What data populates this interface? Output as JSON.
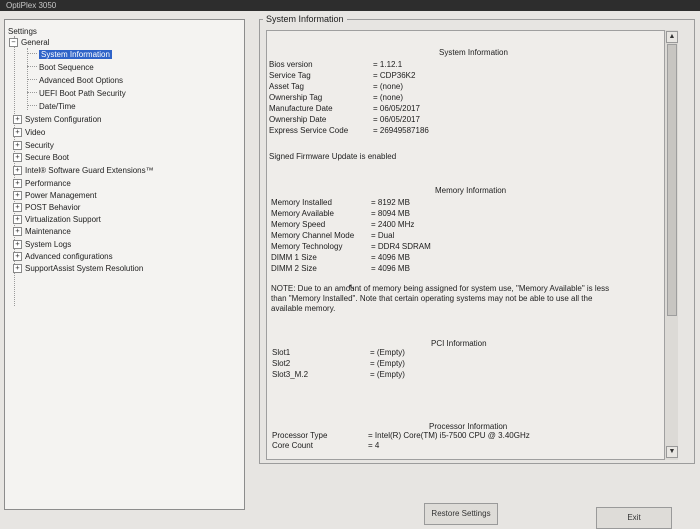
{
  "window": {
    "title": "OptiPlex 3050"
  },
  "tree": {
    "root": "Settings",
    "general": "General",
    "general_items": [
      "System Information",
      "Boot Sequence",
      "Advanced Boot Options",
      "UEFI Boot Path Security",
      "Date/Time"
    ],
    "sections": [
      "System Configuration",
      "Video",
      "Security",
      "Secure Boot",
      "Intel® Software Guard Extensions™",
      "Performance",
      "Power Management",
      "POST Behavior",
      "Virtualization Support",
      "Maintenance",
      "System Logs",
      "Advanced configurations",
      "SupportAssist System Resolution"
    ]
  },
  "panel": {
    "group_title": "System Information",
    "system": {
      "title": "System Information",
      "rows": [
        {
          "k": "Bios version",
          "v": "= 1.12.1"
        },
        {
          "k": "Service Tag",
          "v": "= CDP36K2"
        },
        {
          "k": "Asset Tag",
          "v": "= (none)"
        },
        {
          "k": "Ownership Tag",
          "v": "= (none)"
        },
        {
          "k": "Manufacture Date",
          "v": "= 06/05/2017"
        },
        {
          "k": "Ownership Date",
          "v": "= 06/05/2017"
        },
        {
          "k": "Express Service Code",
          "v": "= 26949587186"
        }
      ],
      "firmware_note": "Signed Firmware Update is enabled"
    },
    "memory": {
      "title": "Memory Information",
      "rows": [
        {
          "k": "Memory Installed",
          "v": "= 8192 MB"
        },
        {
          "k": "Memory Available",
          "v": "= 8094 MB"
        },
        {
          "k": "Memory Speed",
          "v": "= 2400 MHz"
        },
        {
          "k": "Memory Channel Mode",
          "v": "= Dual"
        },
        {
          "k": "Memory Technology",
          "v": "= DDR4 SDRAM"
        },
        {
          "k": "DIMM 1 Size",
          "v": "= 4096 MB"
        },
        {
          "k": "DIMM 2 Size",
          "v": "= 4096 MB"
        }
      ],
      "note_line1": "NOTE: Due to an amount of memory being assigned for system use, \"Memory Available\" is less",
      "note_line2": "than \"Memory Installed\". Note that certain operating systems may not be able to use all the",
      "note_line3": "available memory."
    },
    "pci": {
      "title": "PCI Information",
      "rows": [
        {
          "k": "Slot1",
          "v": "= (Empty)"
        },
        {
          "k": "Slot2",
          "v": "= (Empty)"
        },
        {
          "k": "Slot3_M.2",
          "v": "= (Empty)"
        }
      ]
    },
    "processor": {
      "title": "Processor Information",
      "rows": [
        {
          "k": "Processor Type",
          "v": "= Intel(R) Core(TM) i5-7500 CPU @ 3.40GHz"
        },
        {
          "k": "Core Count",
          "v": "= 4"
        }
      ]
    }
  },
  "buttons": {
    "restore": "Restore Settings",
    "exit": "Exit"
  },
  "colors": {
    "selection": "#2f63c8",
    "background": "#e7e5e2"
  }
}
